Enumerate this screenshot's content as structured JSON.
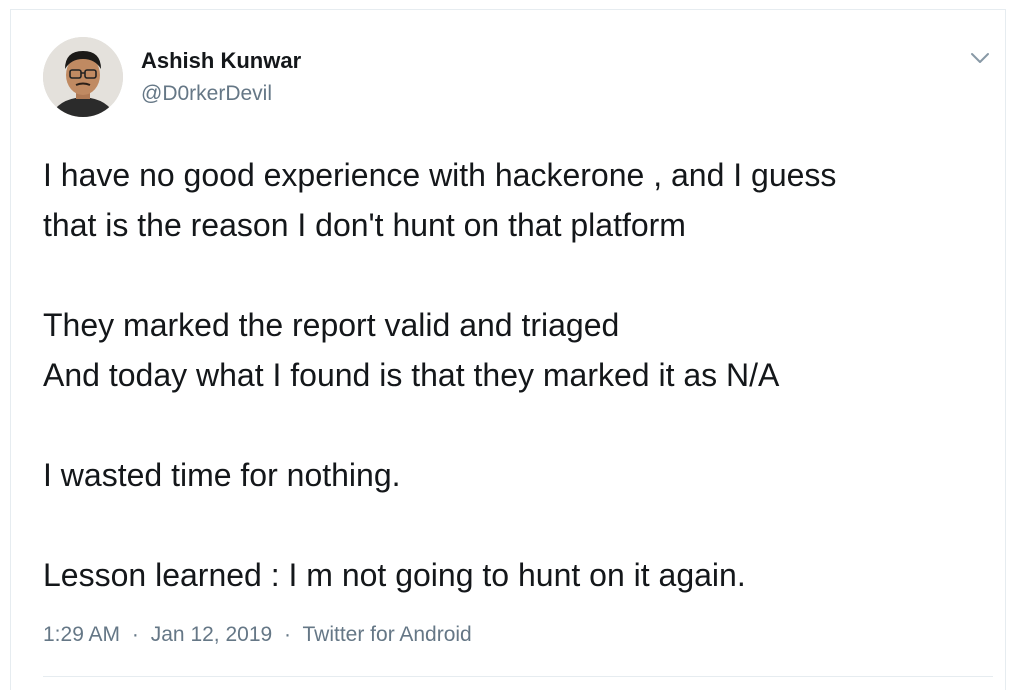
{
  "tweet": {
    "author": {
      "name": "Ashish Kunwar",
      "handle": "@D0rkerDevil",
      "avatar_icon": "user-avatar"
    },
    "menu_icon": "chevron-down-icon",
    "lines": [
      "I have no good experience with hackerone , and I guess",
      "that is the reason I don't hunt on that platform",
      "",
      "They marked the report valid and triaged",
      "And today what I found is that they marked it as N/A",
      "",
      "I wasted time for nothing.",
      "",
      "Lesson learned : I m not going to hunt on it again."
    ],
    "meta": {
      "time": "1:29 AM",
      "date": "Jan 12, 2019",
      "source": "Twitter for Android",
      "separator": "·"
    }
  },
  "colors": {
    "text": "#14171a",
    "secondary": "#657786",
    "border": "#e6ecf0"
  }
}
